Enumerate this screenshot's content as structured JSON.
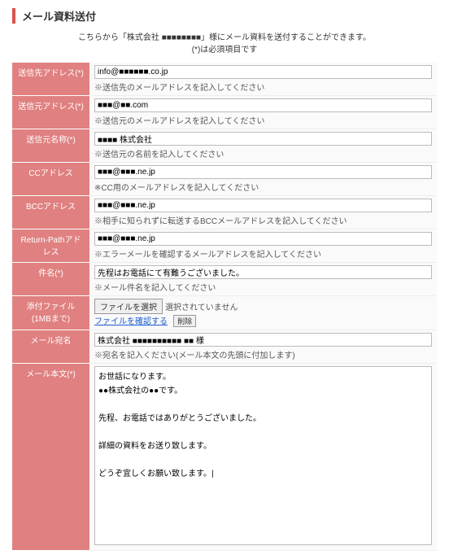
{
  "page_title": "メール資料送付",
  "intro_line1": "こちらから「株式会社 ■■■■■■■■」様にメール資料を送付することができます。",
  "intro_line2": "(*)は必須項目です",
  "rows": {
    "to": {
      "label": "送信先アドレス(*)",
      "value": "info@■■■■■■.co.jp",
      "hint": "※送信先のメールアドレスを記入してください"
    },
    "from": {
      "label": "送信元アドレス(*)",
      "value": "■■■@■■.com",
      "hint": "※送信元のメールアドレスを記入してください"
    },
    "fromname": {
      "label": "送信元名称(*)",
      "value": "■■■■ 株式会社",
      "hint": "※送信元の名前を記入してください"
    },
    "cc": {
      "label": "CCアドレス",
      "value": "■■■@■■■.ne.jp",
      "hint": "※CC用のメールアドレスを記入してください"
    },
    "bcc": {
      "label": "BCCアドレス",
      "value": "■■■@■■■.ne.jp",
      "hint": "※相手に知られずに転送するBCCメールアドレスを記入してください"
    },
    "return": {
      "label": "Return-Pathアドレス",
      "value": "■■■@■■■.ne.jp",
      "hint": "※エラーメールを確認するメールアドレスを記入してください"
    },
    "subject": {
      "label": "件名(*)",
      "value": "先程はお電話にて有難うございました。",
      "hint": "※メール件名を記入してください"
    },
    "attach": {
      "label": "添付ファイル\n(1MBまで)",
      "btn": "ファイルを選択",
      "status": "選択されていません",
      "link": "ファイルを確認する",
      "del": "削除"
    },
    "addressee": {
      "label": "メール宛名",
      "value": "株式会社 ■■■■■■■■\n■■ ■■ 様",
      "hint": "※宛名を記入ください(メール本文の先頭に付加します)"
    },
    "body": {
      "label": "メール本文(*)",
      "value": "お世話になります。\n●●株式会社の●●です。\n\n先程、お電話ではありがとうございました。\n\n詳細の資料をお送り致します。\n\nどうぞ宜しくお願い致します。|"
    }
  }
}
